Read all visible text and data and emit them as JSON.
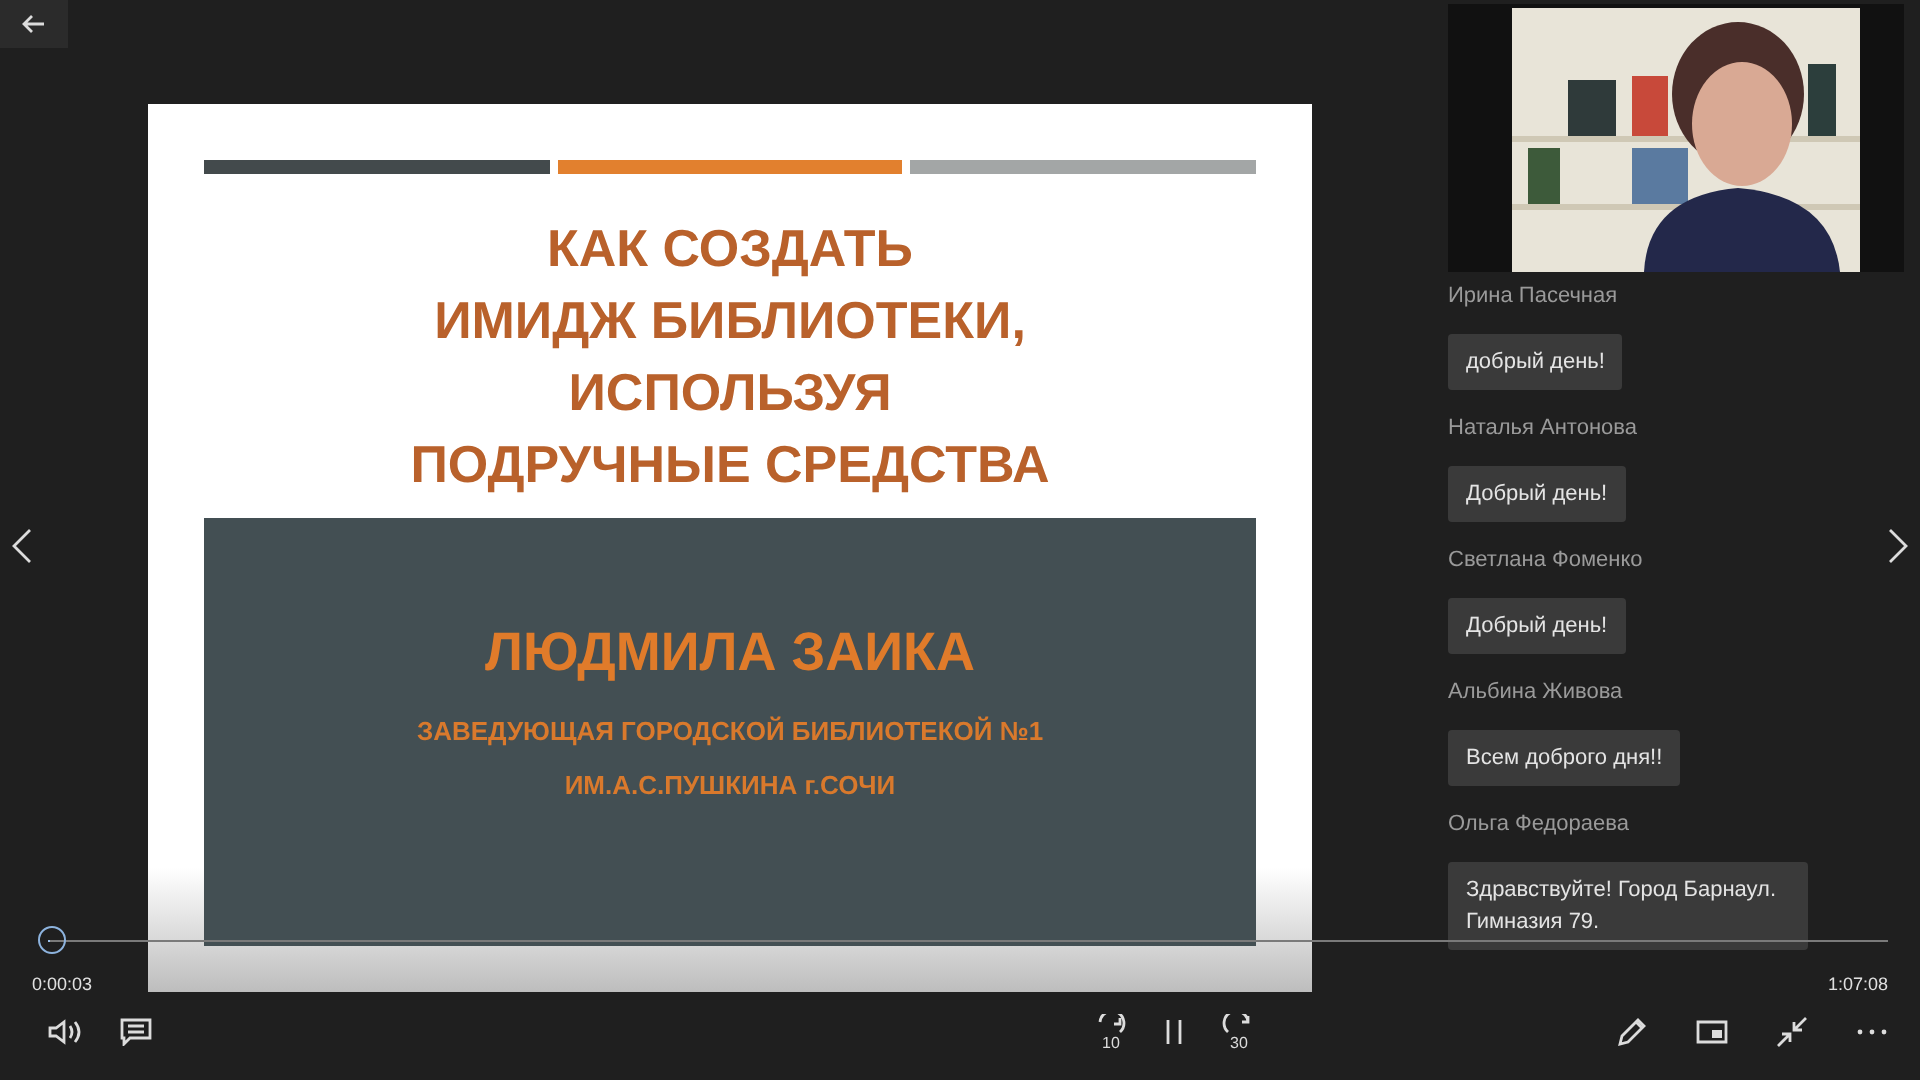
{
  "slide": {
    "title_lines": [
      "КАК СОЗДАТЬ",
      "ИМИДЖ БИБЛИОТЕКИ,",
      "ИСПОЛЬЗУЯ",
      "ПОДРУЧНЫЕ СРЕДСТВА"
    ],
    "author": "ЛЮДМИЛА ЗАИКА",
    "position_lines": [
      "ЗАВЕДУЮЩАЯ ГОРОДСКОЙ БИБЛИОТЕКОЙ №1",
      "ИМ.А.С.ПУШКИНА г.СОЧИ"
    ]
  },
  "chat": {
    "messages": [
      {
        "author": "Ирина Пасечная",
        "text": "добрый день!"
      },
      {
        "author": "Наталья Антонова",
        "text": "Добрый день!"
      },
      {
        "author": "Светлана Фоменко",
        "text": "Добрый день!"
      },
      {
        "author": "Альбина Живова",
        "text": "Всем доброго дня!!"
      },
      {
        "author": "Ольга Федораева",
        "text": "Здравствуйте! Город Барнаул. Гимназия 79."
      }
    ]
  },
  "player": {
    "elapsed": "0:00:03",
    "duration": "1:07:08",
    "progress": {
      "level": 0.001
    },
    "playing": true,
    "skip_back": "10",
    "skip_forward": "30"
  }
}
